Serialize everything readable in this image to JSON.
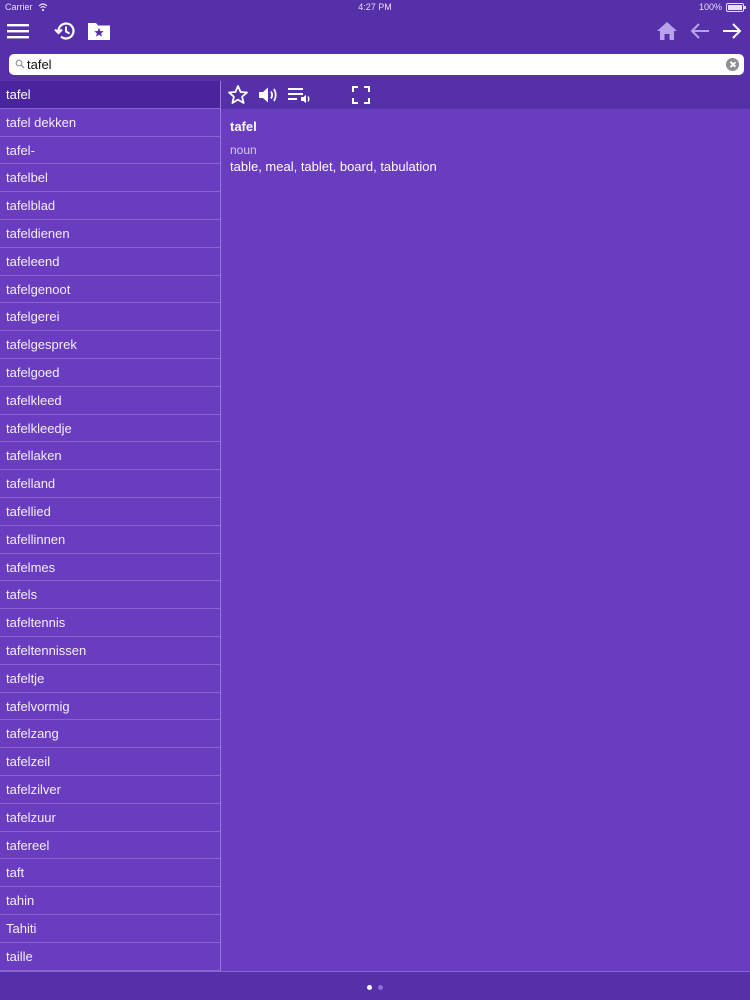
{
  "status": {
    "carrier": "Carrier",
    "time": "4:27 PM",
    "battery": "100%"
  },
  "toolbar": {
    "left_icons": [
      "menu-icon",
      "history-icon",
      "favorites-folder-icon"
    ],
    "right_icons": [
      "home-icon",
      "back-arrow-icon",
      "forward-arrow-icon"
    ]
  },
  "search": {
    "value": "tafel",
    "placeholder": ""
  },
  "wordlist": {
    "selected_index": 0,
    "items": [
      "tafel",
      "tafel dekken",
      "tafel-",
      "tafelbel",
      "tafelblad",
      "tafeldienen",
      "tafeleend",
      "tafelgenoot",
      "tafelgerei",
      "tafelgesprek",
      "tafelgoed",
      "tafelkleed",
      "tafelkleedje",
      "tafellaken",
      "tafelland",
      "tafellied",
      "tafellinnen",
      "tafelmes",
      "tafels",
      "tafeltennis",
      "tafeltennissen",
      "tafeltje",
      "tafelvormig",
      "tafelzang",
      "tafelzeil",
      "tafelzilver",
      "tafelzuur",
      "tafereel",
      "taft",
      "tahin",
      "Tahiti",
      "taille"
    ]
  },
  "detail_toolbar": {
    "icons": [
      "star-icon",
      "speaker-icon",
      "playlist-audio-icon",
      "fullscreen-icon"
    ]
  },
  "entry": {
    "headword": "tafel",
    "part_of_speech": "noun",
    "definition": "table, meal, tablet, board, tabulation"
  },
  "pager": {
    "pages": 2,
    "current": 1
  },
  "colors": {
    "toolbar_bg": "#5530a8",
    "content_bg": "#6a3cbf",
    "selected_row_bg": "#4a249c",
    "divider": "#8a64d0"
  }
}
